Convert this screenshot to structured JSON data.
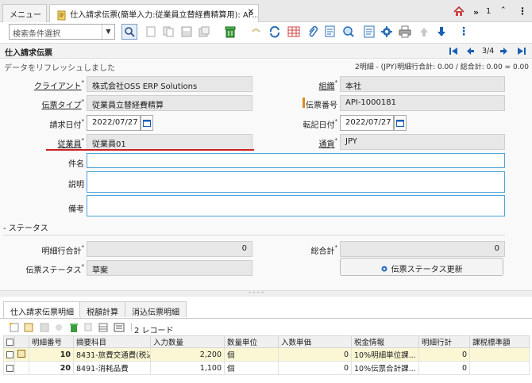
{
  "tabs": {
    "menu_label": "メニュー",
    "active_label": "仕入請求伝票(簡単入力:従業員立替経費精算用): AP...",
    "close_glyph": "✕",
    "right_count": "1"
  },
  "toolbar": {
    "search_placeholder": "検索条件選択"
  },
  "window": {
    "title": "仕入請求伝票",
    "nav_position": "3/4",
    "status_message": "データをリフレッシュしました",
    "summary": "2明細 - (JPY)明細行合計: 0.00 / 総合計: 0.00 = 0.00"
  },
  "form": {
    "client_label": "クライアント",
    "client_value": "株式会社OSS ERP Solutions",
    "org_label": "組織",
    "org_value": "本社",
    "doctype_label": "伝票タイプ",
    "doctype_value": "従業員立替経費精算",
    "docno_label": "伝票番号",
    "docno_value": "API-1000181",
    "invoice_date_label": "請求日付",
    "invoice_date_value": "2022/07/27",
    "acct_date_label": "転記日付",
    "acct_date_value": "2022/07/27",
    "employee_label": "従業員",
    "employee_value": "従業員01",
    "currency_label": "通貨",
    "currency_value": "JPY",
    "subject_label": "件名",
    "description_label": "説明",
    "remarks_label": "備考",
    "status_section_label": "- ステータス",
    "line_total_label": "明細行合計",
    "line_total_value": "0",
    "grand_total_label": "総合計",
    "grand_total_value": "0",
    "doc_status_label": "伝票ステータス",
    "doc_status_value": "草案",
    "update_status_button": "伝票ステータス更新"
  },
  "detail": {
    "tabs": [
      "仕入請求伝票明細",
      "税額計算",
      "消込伝票明細"
    ],
    "record_count": "2 レコード",
    "columns": [
      "明細番号",
      "摘要科目",
      "入力数量",
      "数量単位",
      "入数単価",
      "税金情報",
      "明細行計",
      "課税標準額"
    ],
    "rows": [
      {
        "line": "10",
        "charge": "8431-旅費交通費(税込)",
        "qty": "2,200",
        "uom": "個",
        "price": "0",
        "tax": "10%明細単位課...",
        "linetotal": "0"
      },
      {
        "line": "20",
        "charge": "8491-消耗品費",
        "qty": "1,100",
        "uom": "個",
        "price": "0",
        "tax": "10%伝票合計課...",
        "linetotal": "0"
      }
    ]
  },
  "colors": {
    "accent": "#1a5fb4",
    "highlight_underline": "#cc1f1f",
    "focus_border": "#4aa3df",
    "selected_row": "#fbf7d4"
  }
}
